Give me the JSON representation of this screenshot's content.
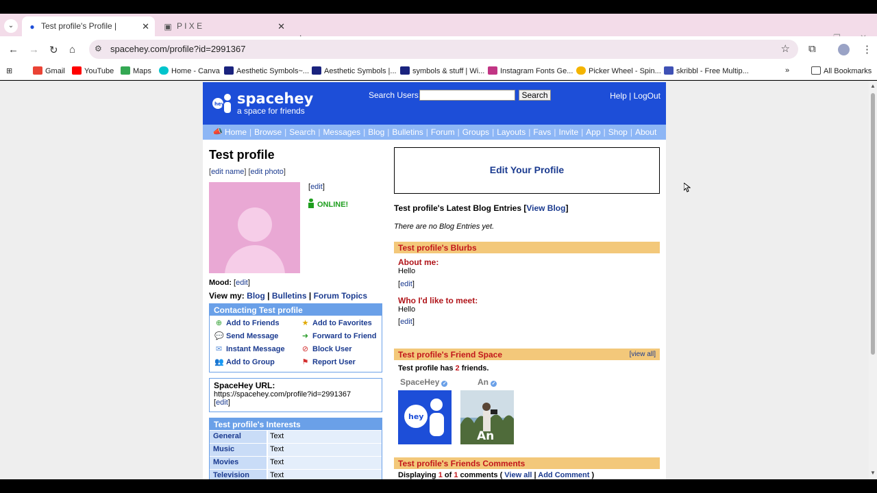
{
  "browser": {
    "tabs": [
      {
        "title": "Test profile's Profile | SpaceHey",
        "favicon": "spacehey-favicon"
      },
      {
        "title": "P I X E",
        "favicon": "pixel-favicon"
      }
    ],
    "url": "spacehey.com/profile?id=2991367",
    "bookmarks": [
      {
        "label": "Gmail",
        "color": "#ea4335"
      },
      {
        "label": "YouTube",
        "color": "#ff0000"
      },
      {
        "label": "Maps",
        "color": "#34a853"
      },
      {
        "label": "Home - Canva",
        "color": "#00c4cc"
      },
      {
        "label": "Aesthetic Symbols~...",
        "color": "#1a237e"
      },
      {
        "label": "Aesthetic Symbols |...",
        "color": "#1a237e"
      },
      {
        "label": "symbols & stuff | Wi...",
        "color": "#1a237e"
      },
      {
        "label": "Instagram Fonts Ge...",
        "color": "#c13584"
      },
      {
        "label": "Picker Wheel - Spin...",
        "color": "#f4b400"
      },
      {
        "label": "skribbl - Free Multip...",
        "color": "#3f51b5"
      }
    ],
    "all_bookmarks": "All Bookmarks"
  },
  "site": {
    "logo_name": "spacehey",
    "logo_tag": "a space for friends",
    "search_label": "Search Users:",
    "search_button": "Search",
    "help": "Help",
    "logout": "LogOut",
    "nav": [
      "Home",
      "Browse",
      "Search",
      "Messages",
      "Blog",
      "Bulletins",
      "Forum",
      "Groups",
      "Layouts",
      "Favs",
      "Invite",
      "App",
      "Shop",
      "About"
    ]
  },
  "profile": {
    "name": "Test profile",
    "edit_name": "edit name",
    "edit_photo": "edit photo",
    "edit": "edit",
    "status": "ONLINE!",
    "mood_label": "Mood:",
    "view_my": "View my:",
    "view_links": [
      "Blog",
      "Bulletins",
      "Forum Topics"
    ],
    "contact_title": "Contacting Test profile",
    "contact": [
      "Add to Friends",
      "Add to Favorites",
      "Send Message",
      "Forward to Friend",
      "Instant Message",
      "Block User",
      "Add to Group",
      "Report User"
    ],
    "url_title": "SpaceHey URL:",
    "url": "https://spacehey.com/profile?id=2991367",
    "interests_title": "Test profile's Interests",
    "interests": [
      {
        "k": "General",
        "v": "Text"
      },
      {
        "k": "Music",
        "v": "Text"
      },
      {
        "k": "Movies",
        "v": "Text"
      },
      {
        "k": "Television",
        "v": "Text"
      }
    ]
  },
  "right": {
    "edit_profile": "Edit Your Profile",
    "blog_heading": "Test profile's Latest Blog Entries [",
    "view_blog": "View Blog",
    "blog_close": "]",
    "no_blog": "There are no Blog Entries yet.",
    "blurbs_title": "Test profile's Blurbs",
    "about_label": "About me:",
    "about_text": "Hello",
    "meet_label": "Who I'd like to meet:",
    "meet_text": "Hello",
    "friends_title": "Test profile's Friend Space",
    "view_all": "[view all]",
    "friends_count_pre": "Test profile has ",
    "friends_count": "2",
    "friends_count_post": " friends.",
    "friends": [
      {
        "name": "SpaceHey"
      },
      {
        "name": "An"
      }
    ],
    "comments_title": "Test profile's Friends Comments",
    "disp_pre": "Displaying ",
    "disp_n1": "1",
    "disp_of": " of ",
    "disp_n2": "1",
    "disp_post": " comments ( ",
    "view_all_link": "View all",
    "disp_bar": " | ",
    "add_comment": "Add Comment",
    "disp_end": " )"
  }
}
